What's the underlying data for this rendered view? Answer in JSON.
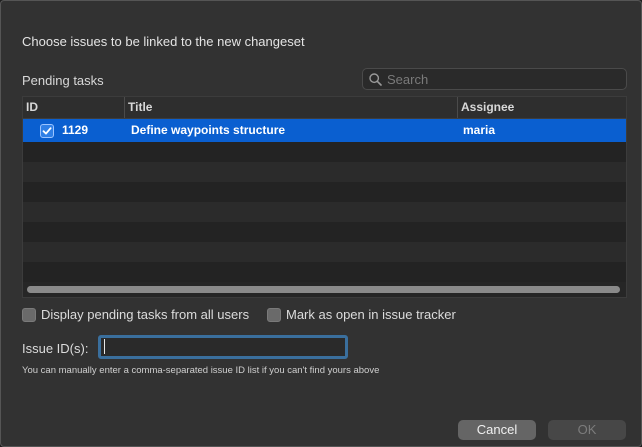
{
  "dialog": {
    "header": "Choose issues to be linked to the new changeset",
    "pending_label": "Pending tasks",
    "search": {
      "placeholder": "Search",
      "value": ""
    }
  },
  "table": {
    "columns": [
      "ID",
      "Title",
      "Assignee"
    ],
    "rows": [
      {
        "checked": true,
        "id": "1129",
        "title": "Define waypoints structure",
        "assignee": "maria",
        "selected": true
      }
    ]
  },
  "options": {
    "display_all_users": {
      "label": "Display pending tasks from all users",
      "checked": false
    },
    "mark_open": {
      "label": "Mark as open in issue tracker",
      "checked": false
    }
  },
  "issue_ids": {
    "label": "Issue ID(s):",
    "value": "",
    "hint": "You can manually enter a comma-separated issue ID list if you can't find yours above"
  },
  "buttons": {
    "cancel": "Cancel",
    "ok": "OK"
  },
  "colors": {
    "selection": "#0a5fd0",
    "focus_ring": "#3a6f9d",
    "dialog_bg": "#323232"
  }
}
